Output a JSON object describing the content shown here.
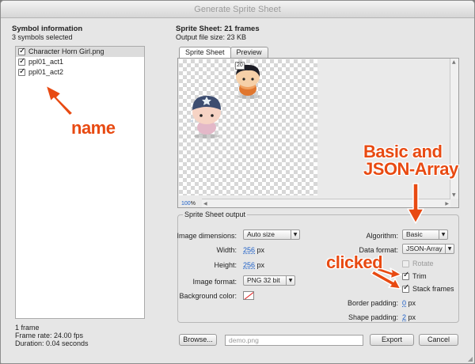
{
  "window": {
    "title": "Generate Sprite Sheet"
  },
  "symbols": {
    "heading": "Symbol information",
    "subheading": "3 symbols selected",
    "items": [
      {
        "label": "Character Horn Girl.png",
        "checked": true
      },
      {
        "label": "ppl01_act1",
        "checked": true
      },
      {
        "label": "ppl01_act2",
        "checked": true
      }
    ],
    "info": {
      "frames": "1 frame",
      "frame_rate": "Frame rate: 24.00 fps",
      "duration": "Duration: 0.04 seconds"
    }
  },
  "sheet": {
    "heading": "Sprite Sheet: 21 frames",
    "file_size": "Output file size: 23 KB",
    "tabs": [
      "Sprite Sheet",
      "Preview"
    ],
    "frame_label": "20",
    "zoom": {
      "value": "100",
      "unit": "%"
    }
  },
  "output": {
    "legend": "Sprite Sheet output",
    "image_dimensions": {
      "label": "Image dimensions:",
      "value": "Auto size"
    },
    "width": {
      "label": "Width:",
      "value": "256",
      "unit": "px"
    },
    "height": {
      "label": "Height:",
      "value": "256",
      "unit": "px"
    },
    "image_format": {
      "label": "Image format:",
      "value": "PNG 32 bit"
    },
    "background_color": {
      "label": "Background color:"
    },
    "algorithm": {
      "label": "Algorithm:",
      "value": "Basic"
    },
    "data_format": {
      "label": "Data format:",
      "value": "JSON-Array"
    },
    "rotate": {
      "label": "Rotate",
      "checked": false,
      "enabled": false
    },
    "trim": {
      "label": "Trim",
      "checked": true
    },
    "stack_frames": {
      "label": "Stack frames",
      "checked": true
    },
    "border_padding": {
      "label": "Border padding:",
      "value": "0",
      "unit": "px"
    },
    "shape_padding": {
      "label": "Shape padding:",
      "value": "2",
      "unit": "px"
    }
  },
  "footer": {
    "browse_label": "Browse...",
    "file_placeholder": "demo.png",
    "export_label": "Export",
    "cancel_label": "Cancel"
  },
  "annotations": {
    "name": "name",
    "basic_line1": "Basic and",
    "basic_line2": "JSON-Array",
    "clicked": "clicked",
    "color": "#e84a12"
  }
}
